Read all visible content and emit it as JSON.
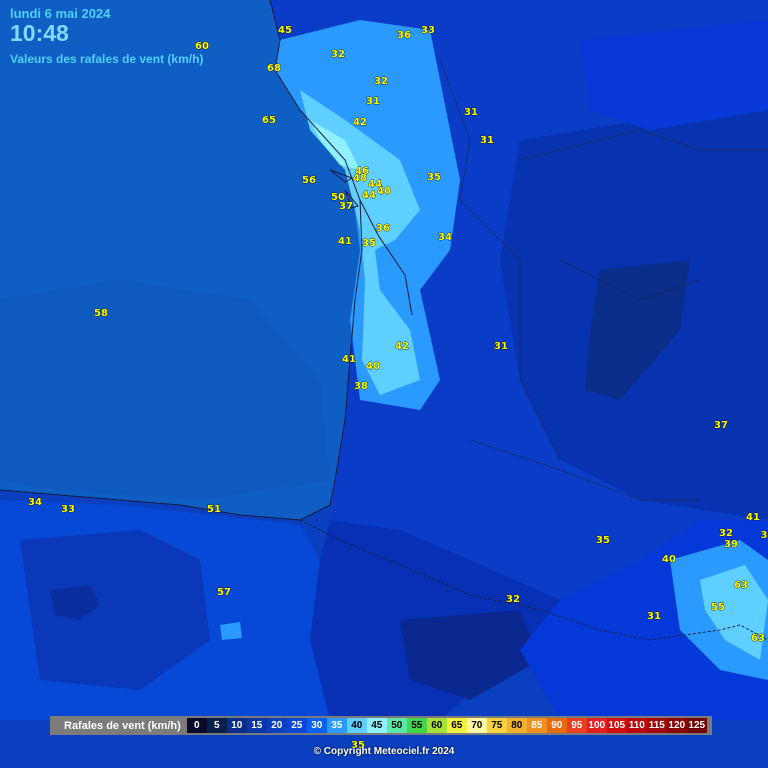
{
  "header": {
    "date": "lundi 6 mai 2024",
    "time": "10:48",
    "subtitle": "Valeurs des rafales de vent (km/h)"
  },
  "legend": {
    "title": "Rafales de vent (km/h)",
    "items": [
      {
        "label": "0",
        "color": "#0a0a2a",
        "text": "#ffffff"
      },
      {
        "label": "5",
        "color": "#0a1e4a",
        "text": "#ffffff"
      },
      {
        "label": "10",
        "color": "#082c8a",
        "text": "#ffffff"
      },
      {
        "label": "15",
        "color": "#0a36a8",
        "text": "#ffffff"
      },
      {
        "label": "20",
        "color": "#0a3fc2",
        "text": "#ffffff"
      },
      {
        "label": "25",
        "color": "#0a47d8",
        "text": "#ffffff"
      },
      {
        "label": "30",
        "color": "#0660f0",
        "text": "#ffffff"
      },
      {
        "label": "35",
        "color": "#2a9aff",
        "text": "#ffffff"
      },
      {
        "label": "40",
        "color": "#5fcfff",
        "text": "#000000"
      },
      {
        "label": "45",
        "color": "#8ff0ff",
        "text": "#000000"
      },
      {
        "label": "50",
        "color": "#5ae8a8",
        "text": "#000000"
      },
      {
        "label": "55",
        "color": "#43d64a",
        "text": "#000000"
      },
      {
        "label": "60",
        "color": "#a8e03a",
        "text": "#000000"
      },
      {
        "label": "65",
        "color": "#f0f040",
        "text": "#000000"
      },
      {
        "label": "70",
        "color": "#fff8a0",
        "text": "#000000"
      },
      {
        "label": "75",
        "color": "#f6d040",
        "text": "#000000"
      },
      {
        "label": "80",
        "color": "#f0b030",
        "text": "#000000"
      },
      {
        "label": "85",
        "color": "#f09020",
        "text": "#ffffff"
      },
      {
        "label": "90",
        "color": "#e86a10",
        "text": "#ffffff"
      },
      {
        "label": "95",
        "color": "#e84020",
        "text": "#ffffff"
      },
      {
        "label": "100",
        "color": "#e02020",
        "text": "#ffffff"
      },
      {
        "label": "105",
        "color": "#d01010",
        "text": "#ffffff"
      },
      {
        "label": "110",
        "color": "#b80a0a",
        "text": "#ffffff"
      },
      {
        "label": "115",
        "color": "#a00808",
        "text": "#ffffff"
      },
      {
        "label": "120",
        "color": "#880606",
        "text": "#ffffff"
      },
      {
        "label": "125",
        "color": "#700404",
        "text": "#ffffff"
      }
    ]
  },
  "stations": [
    "45",
    "32",
    "36",
    "33",
    "60",
    "68",
    "32",
    "31",
    "65",
    "42",
    "31",
    "31",
    "56",
    "46",
    "48",
    "44",
    "35",
    "40",
    "50",
    "44",
    "37",
    "36",
    "34",
    "41",
    "35",
    "58",
    "42",
    "31",
    "41",
    "40",
    "38",
    "37",
    "34",
    "33",
    "51",
    "35",
    "32",
    "41",
    "39",
    "3",
    "40",
    "63",
    "57",
    "32",
    "55",
    "31",
    "63",
    "35"
  ],
  "copyright": "© Copyright Meteociel.fr 2024"
}
